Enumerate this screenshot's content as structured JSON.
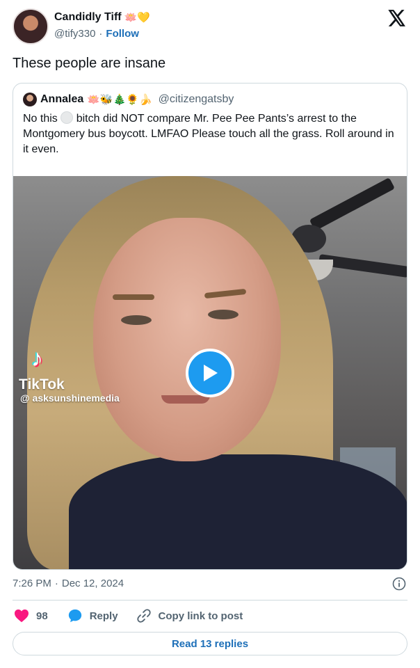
{
  "author": {
    "display_name": "Candidly Tiff",
    "name_emoji": "🪷💛",
    "handle": "@tify330",
    "separator": "·",
    "follow_label": "Follow"
  },
  "tweet": {
    "text": "These people are insane",
    "time": "7:26 PM",
    "separator": "·",
    "date": "Dec 12, 2024"
  },
  "quoted_tweet": {
    "display_name": "Annalea",
    "name_emoji": "🪷🐝🎄🌻🍌",
    "handle": "@citizengatsby",
    "text_part1": "No this",
    "text_part2": "bitch did NOT compare Mr. Pee Pee Pants’s arrest to the Montgomery bus boycott. LMFAO Please touch all the grass. Roll around in it even."
  },
  "video": {
    "watermark_app": "TikTok",
    "watermark_user": "@ asksunshinemedia"
  },
  "actions": {
    "like_count": "98",
    "reply_label": "Reply",
    "copy_link_label": "Copy link to post",
    "read_replies_label": "Read 13 replies"
  },
  "colors": {
    "accent": "#1d9bf0",
    "link": "#1d6fb8",
    "heart": "#f91880",
    "muted_text": "#536471"
  }
}
